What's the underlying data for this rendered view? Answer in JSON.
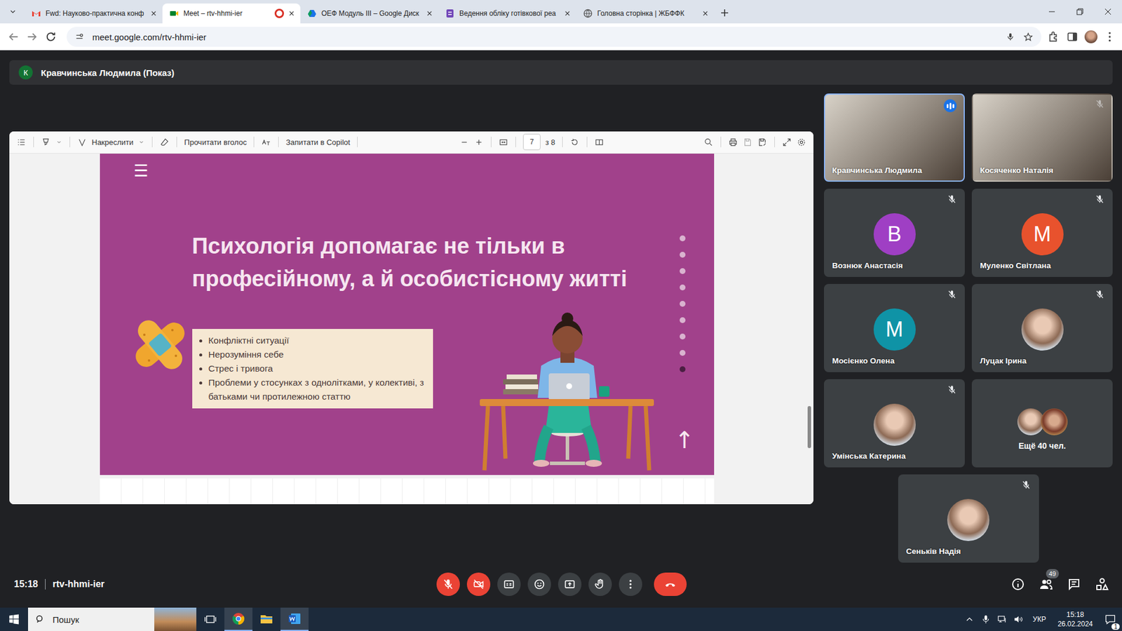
{
  "browser": {
    "tabs": [
      {
        "label": "Fwd: Науково-практична конф",
        "selected": false,
        "recording": false
      },
      {
        "label": "Meet – rtv-hhmi-ier",
        "selected": true,
        "recording": true
      },
      {
        "label": "ОЕФ Модуль III – Google Диск",
        "selected": false,
        "recording": false
      },
      {
        "label": "Ведення обліку готівкової реа",
        "selected": false,
        "recording": false
      },
      {
        "label": "Головна сторінка | ЖБФФК",
        "selected": false,
        "recording": false
      }
    ],
    "url": "meet.google.com/rtv-hhmi-ier"
  },
  "presenter": {
    "initial": "К",
    "label": "Кравчинська Людмила (Показ)"
  },
  "pdf_toolbar": {
    "draw": "Накреслити",
    "read_aloud": "Прочитати вголос",
    "ask": "Запитати в Copilot",
    "page": "7",
    "pages": "з 8"
  },
  "slide": {
    "menu": "☰",
    "title": "Психологія допомагає не тільки в професійному, а й особистісному житті",
    "bullets": [
      "Конфліктні ситуації",
      "Нерозуміння себе",
      "Стрес і тривога",
      "Проблеми у стосунках з однолітками, у колективі, з батьками чи протилежною статтю"
    ],
    "dots": [
      {
        "selected": false
      },
      {
        "selected": false
      },
      {
        "selected": false
      },
      {
        "selected": false
      },
      {
        "selected": false
      },
      {
        "selected": false
      },
      {
        "selected": false
      },
      {
        "selected": false
      },
      {
        "selected": true
      }
    ],
    "up": "↑"
  },
  "participants": [
    {
      "kind": "video",
      "name": "Кравчинська Людмила",
      "muted": false,
      "speaking": true
    },
    {
      "kind": "video",
      "name": "Косяченко Наталія",
      "muted": true,
      "speaking": false
    },
    {
      "kind": "letter",
      "name": "Вознюк Анастасія",
      "letter": "В",
      "color": "#9f3fc4",
      "muted": true,
      "speaking": false
    },
    {
      "kind": "letter",
      "name": "Муленко Світлана",
      "letter": "М",
      "color": "#e8522d",
      "muted": true,
      "speaking": false
    },
    {
      "kind": "letter",
      "name": "Мосієнко Олена",
      "letter": "М",
      "color": "#0f93a6",
      "muted": true,
      "speaking": false
    },
    {
      "kind": "photo",
      "name": "Луцак Ірина",
      "muted": true,
      "speaking": false
    },
    {
      "kind": "photo",
      "name": "Умінська Катерина",
      "muted": true,
      "speaking": false
    },
    {
      "kind": "more",
      "name": "Ещё 40 чел.",
      "muted": false,
      "speaking": false
    },
    {
      "kind": "photo",
      "name": "Сеньків Надія",
      "muted": true,
      "speaking": false
    }
  ],
  "meeting": {
    "time": "15:18",
    "code": "rtv-hhmi-ier",
    "people_count": "49",
    "mic_on": false,
    "camera_on": false
  },
  "taskbar": {
    "search": "Пошук",
    "language": "УКР",
    "time": "15:18",
    "date": "26.02.2024",
    "notifications": "1"
  }
}
